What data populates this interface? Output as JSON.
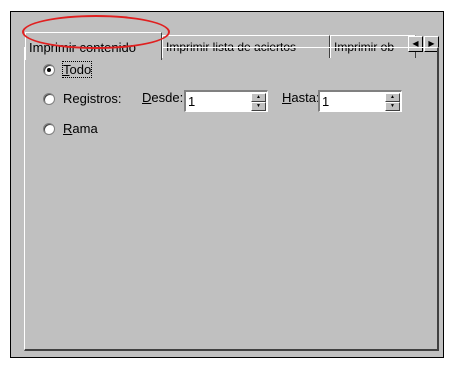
{
  "tabs": [
    {
      "label": "Imprimir contenido",
      "active": true
    },
    {
      "label": "Imprimir lista de aciertos",
      "active": false
    },
    {
      "label": "Imprimir ob",
      "active": false
    }
  ],
  "tab_scroll": {
    "left_glyph": "◀",
    "right_glyph": "▶"
  },
  "options": {
    "todo": {
      "accel": "T",
      "rest": "odo",
      "selected": true
    },
    "registros": {
      "label": "Registros:",
      "selected": false
    },
    "rama": {
      "accel": "R",
      "rest": "ama",
      "selected": false
    }
  },
  "desde": {
    "accel": "D",
    "rest": "esde:",
    "value": "1"
  },
  "hasta": {
    "accel": "H",
    "rest": "asta:",
    "value": "1"
  },
  "spin_glyphs": {
    "up": "▲",
    "down": "▼"
  },
  "annotation_color": "#e02020"
}
